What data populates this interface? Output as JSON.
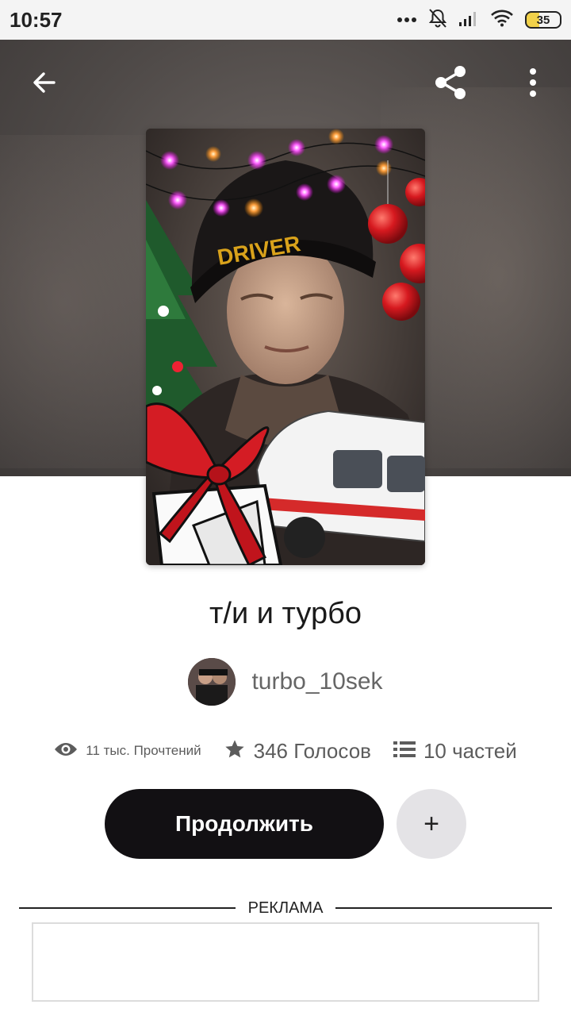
{
  "status_bar": {
    "time": "10:57",
    "battery": "35",
    "icons": [
      "more-dots-icon",
      "bell-muted-icon",
      "signal-icon",
      "wifi-icon",
      "battery-icon"
    ]
  },
  "toolbar": {
    "back_icon": "arrow-left-icon",
    "share_icon": "share-icon",
    "menu_icon": "more-vertical-icon"
  },
  "story": {
    "title": "т/и и турбо",
    "author": "turbo_10sek",
    "cover_text": "DRIVER",
    "stats": {
      "reads": "11 тыс. Прочтений",
      "votes": "346 Голосов",
      "parts": "10 частей"
    }
  },
  "actions": {
    "continue_label": "Продолжить",
    "add_label": "+"
  },
  "ad": {
    "label": "РЕКЛАМА"
  },
  "colors": {
    "primary_button": "#121013",
    "secondary_button": "#e4e3e6",
    "hero_bg": "#4f4a48"
  }
}
